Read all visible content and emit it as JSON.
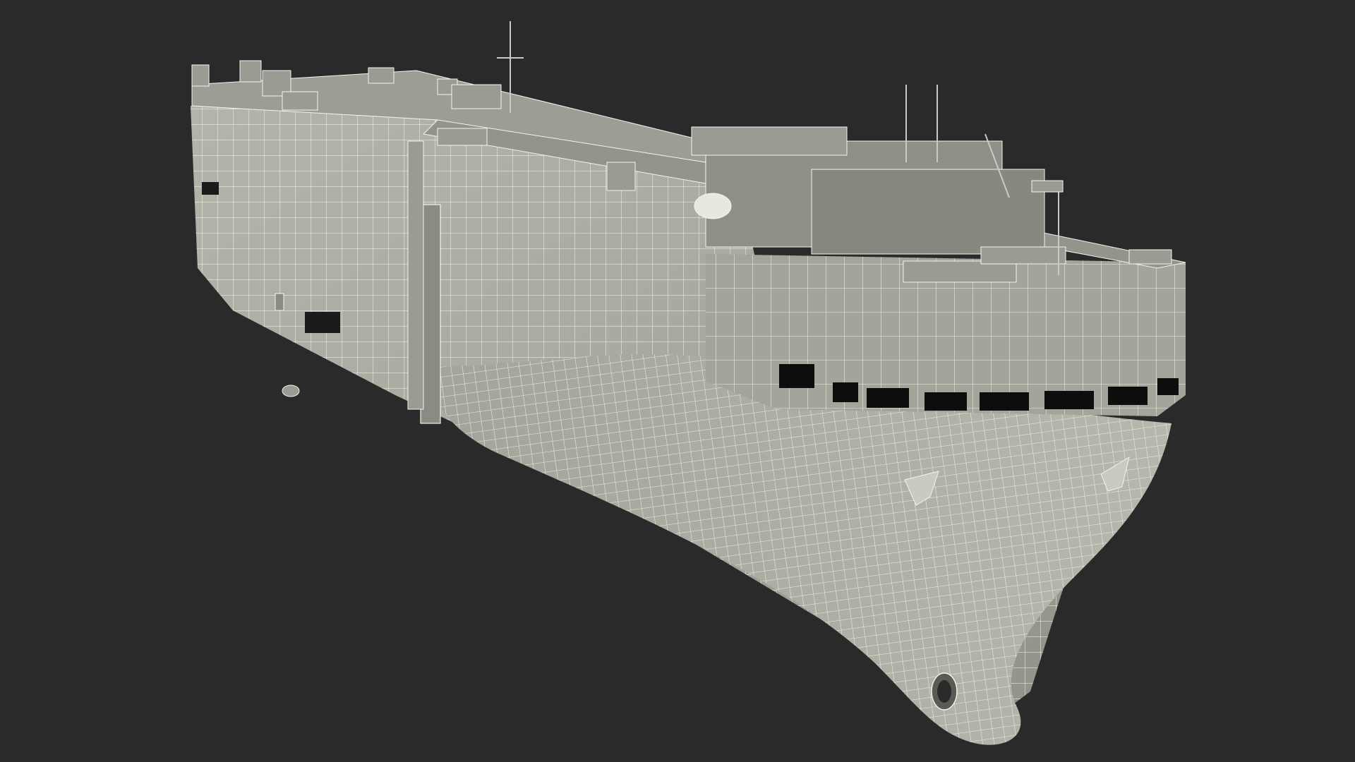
{
  "scene": {
    "subject": "ship-hull-wireframe",
    "colors": {
      "background": "#2a2a2a",
      "hull_fill": "#a9aaa0",
      "hull_shade": "#8f9087",
      "deck_fill": "#9c9d94",
      "wire": "#f2f2ea",
      "window": "#0d0d0d"
    }
  }
}
